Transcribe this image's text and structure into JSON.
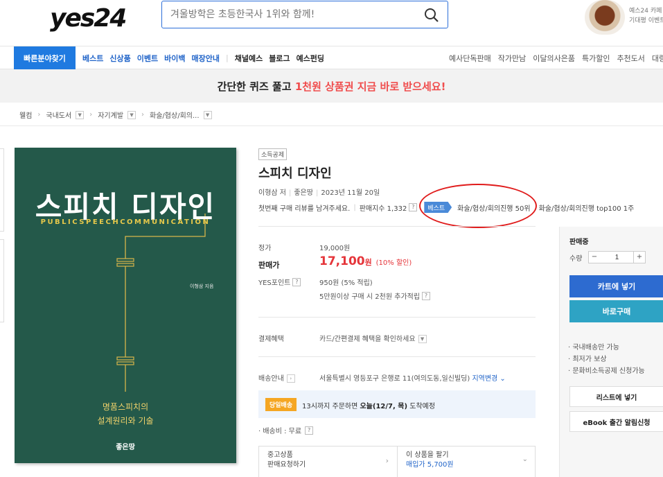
{
  "header": {
    "logo": "yes24",
    "search_placeholder": "겨울방학은 초등한국사 1위와 함께!",
    "promo_line1": "예스24 카페",
    "promo_line2": "기대평 이벤트"
  },
  "nav": {
    "quick_find": "빠른분야찾기",
    "left_items": [
      "베스트",
      "신상품",
      "이벤트",
      "바이백",
      "매장안내"
    ],
    "left_items2": [
      "채널예스",
      "블로그",
      "예스펀딩"
    ],
    "right_items": [
      "예사단독판매",
      "작가만남",
      "이달의사은품",
      "특가할인",
      "추천도서",
      "대량"
    ]
  },
  "banner": {
    "text1": "간단한 퀴즈 풀고 ",
    "text2": "1천원 상품권 지금 바로 받으세요!"
  },
  "breadcrumb": [
    "웰컴",
    "국내도서",
    "자기계발",
    "화술/협상/회의..."
  ],
  "cover": {
    "title": "스피치 디자인",
    "subtitle": "PUBLICSPEECHCOMMUNICATION",
    "author": "이형삼 지음",
    "desc_line1": "명품스피치의",
    "desc_line2": "설계원리와 기술",
    "publisher": "좋은땅"
  },
  "product": {
    "tag": "소득공제",
    "title": "스피치 디자인",
    "author": "이형삼 저",
    "publisher": "좋은땅",
    "date": "2023년 11월 20일",
    "review_prompt": "첫번째 구매 리뷰를 남겨주세요.",
    "sales_index": "판매지수 1,332",
    "best_badge": "베스트",
    "best_rank": "화술/협상/회의진행 50위",
    "top100": "화술/협상/회의진행 top100 1주"
  },
  "pricing": {
    "list_label": "정가",
    "list_price": "19,000원",
    "sale_label": "판매가",
    "sale_price": "17,100",
    "sale_unit": "원",
    "discount": "(10% 할인)",
    "point_label": "YES포인트",
    "point_value": "950원 (5% 적립)",
    "point_extra": "5만원이상 구매 시 2천원 추가적립"
  },
  "payment": {
    "label": "결제혜택",
    "value": "카드/간편결제 혜택을 확인하세요"
  },
  "shipping": {
    "label": "배송안내",
    "address": "서울특별시 영등포구 은행로 11(여의도동,일신빌딩)",
    "change": "지역변경",
    "today_badge": "당일배송",
    "delivery_text1": "13시까지 주문하면 ",
    "delivery_bold": "오늘(12/7, 목)",
    "delivery_text2": " 도착예정",
    "fee": "· 배송비 : 무료"
  },
  "used": {
    "left_line1": "중고상품",
    "left_line2": "판매요청하기",
    "right_line1": "이 상품을 팔기",
    "right_line2": "매입가 5,700원"
  },
  "panel": {
    "title": "판매중",
    "qty_label": "수량",
    "qty_value": "1",
    "cart": "카트에 넣기",
    "buy": "바로구매",
    "notes": [
      "· 국내배송만 가능",
      "· 최저가 보상",
      "· 문화비소득공제 신청가능"
    ],
    "wishlist": "리스트에 넣기",
    "ebook": "eBook 출간 알림신청"
  },
  "colors": {
    "brand_blue": "#1f7ae0",
    "sale_red": "#e5353a",
    "cover_green": "#24594a",
    "cover_gold": "#e6c84a",
    "annotation_red": "#e01b1b"
  }
}
